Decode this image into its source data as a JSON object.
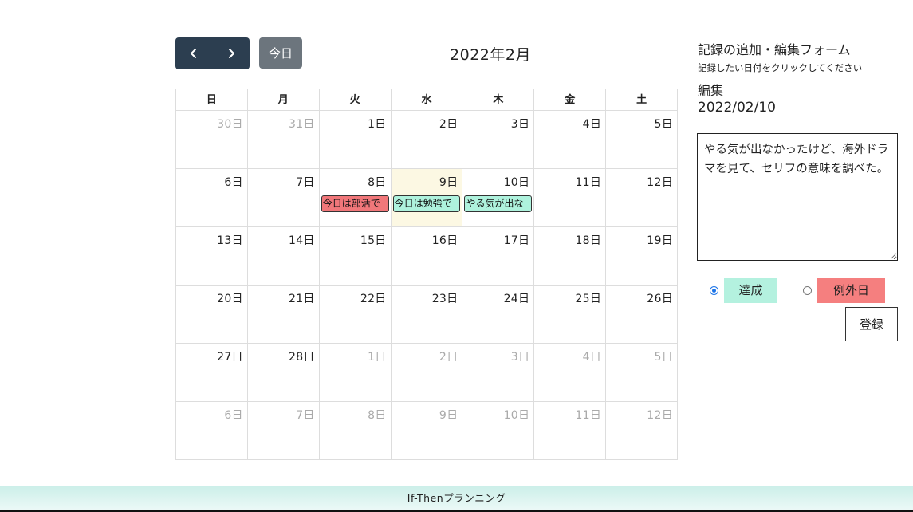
{
  "toolbar": {
    "prev_icon": "chevron-left-icon",
    "next_icon": "chevron-right-icon",
    "today_label": "今日"
  },
  "calendar": {
    "title": "2022年2月",
    "weekdays": [
      "日",
      "月",
      "火",
      "水",
      "木",
      "金",
      "土"
    ],
    "weeks": [
      [
        {
          "label": "30日",
          "other": true
        },
        {
          "label": "31日",
          "other": true
        },
        {
          "label": "1日"
        },
        {
          "label": "2日"
        },
        {
          "label": "3日"
        },
        {
          "label": "4日"
        },
        {
          "label": "5日"
        }
      ],
      [
        {
          "label": "6日"
        },
        {
          "label": "7日"
        },
        {
          "label": "8日",
          "event": {
            "text": "今日は部活で",
            "color": "red"
          }
        },
        {
          "label": "9日",
          "today": true,
          "event": {
            "text": "今日は勉強で",
            "color": "green"
          }
        },
        {
          "label": "10日",
          "event": {
            "text": "やる気が出な",
            "color": "green"
          }
        },
        {
          "label": "11日"
        },
        {
          "label": "12日"
        }
      ],
      [
        {
          "label": "13日"
        },
        {
          "label": "14日"
        },
        {
          "label": "15日"
        },
        {
          "label": "16日"
        },
        {
          "label": "17日"
        },
        {
          "label": "18日"
        },
        {
          "label": "19日"
        }
      ],
      [
        {
          "label": "20日"
        },
        {
          "label": "21日"
        },
        {
          "label": "22日"
        },
        {
          "label": "23日"
        },
        {
          "label": "24日"
        },
        {
          "label": "25日"
        },
        {
          "label": "26日"
        }
      ],
      [
        {
          "label": "27日"
        },
        {
          "label": "28日"
        },
        {
          "label": "1日",
          "other": true
        },
        {
          "label": "2日",
          "other": true
        },
        {
          "label": "3日",
          "other": true
        },
        {
          "label": "4日",
          "other": true
        },
        {
          "label": "5日",
          "other": true
        }
      ],
      [
        {
          "label": "6日",
          "other": true
        },
        {
          "label": "7日",
          "other": true
        },
        {
          "label": "8日",
          "other": true
        },
        {
          "label": "9日",
          "other": true
        },
        {
          "label": "10日",
          "other": true
        },
        {
          "label": "11日",
          "other": true
        },
        {
          "label": "12日",
          "other": true
        }
      ]
    ]
  },
  "form": {
    "title": "記録の追加・編集フォーム",
    "instruction": "記録したい日付をクリックしてください",
    "mode": "編集",
    "date": "2022/02/10",
    "memo": "やる気が出なかったけど、海外ドラマを見て、セリフの意味を調べた。",
    "options": {
      "achieved": "達成",
      "exception": "例外日"
    },
    "selected": "achieved",
    "submit_label": "登録"
  },
  "footer": {
    "text": "If-Thenプランニング"
  },
  "colors": {
    "nav_bg": "#2c3e50",
    "today_btn": "#6c757d",
    "event_red": "#f1777a",
    "event_green": "#aef2dd",
    "today_cell": "#fcf8e3"
  }
}
